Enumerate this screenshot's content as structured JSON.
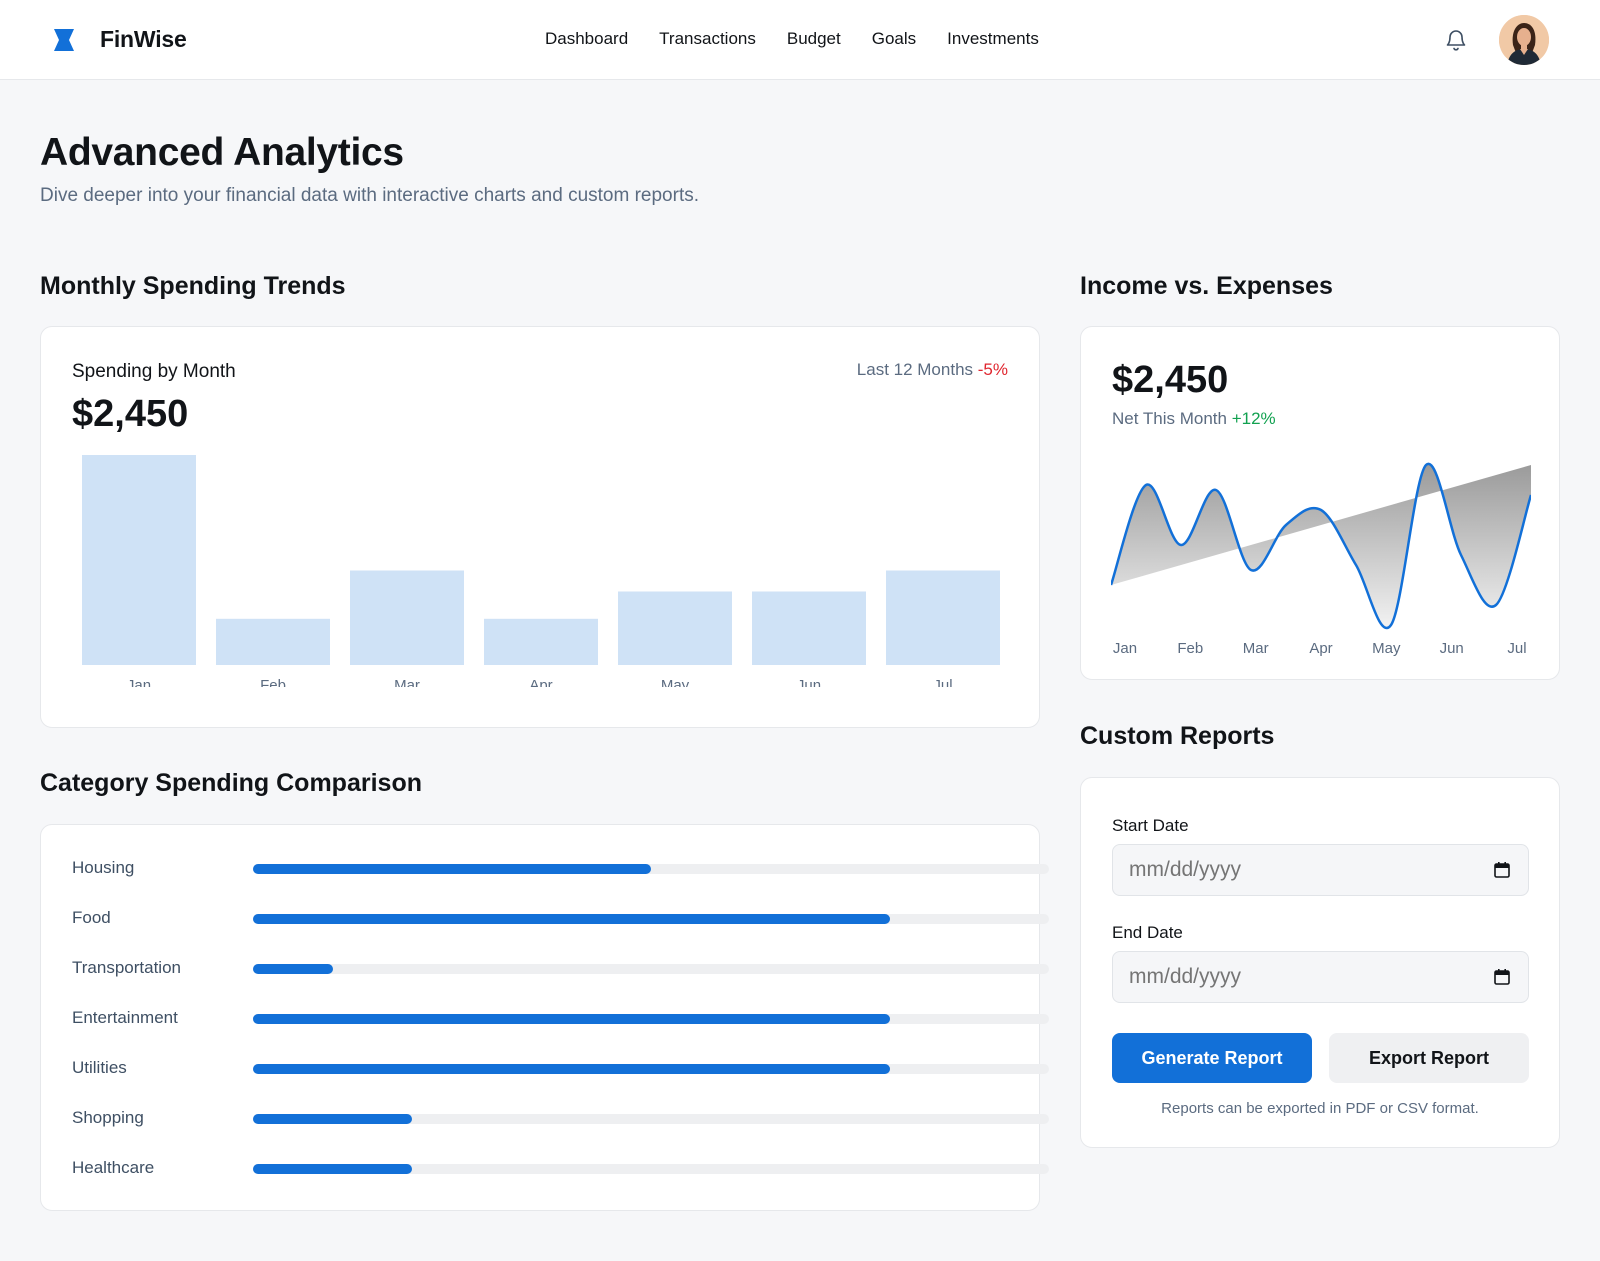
{
  "app": {
    "brand": "FinWise",
    "nav": [
      "Dashboard",
      "Transactions",
      "Budget",
      "Goals",
      "Investments"
    ],
    "accent": "#1270d8"
  },
  "page": {
    "title": "Advanced Analytics",
    "subtitle": "Dive deeper into your financial data with interactive charts and custom reports."
  },
  "spending": {
    "section_title": "Monthly Spending Trends",
    "label": "Spending by Month",
    "value": "$2,450",
    "range_label": "Last 12 Months",
    "change": "-5%"
  },
  "income": {
    "section_title": "Income vs. Expenses",
    "value": "$2,450",
    "label": "Net This Month",
    "change": "+12%"
  },
  "categories": {
    "section_title": "Category Spending Comparison",
    "items": [
      {
        "name": "Housing",
        "fraction": 0.5
      },
      {
        "name": "Food",
        "fraction": 0.8
      },
      {
        "name": "Transportation",
        "fraction": 0.1
      },
      {
        "name": "Entertainment",
        "fraction": 0.8
      },
      {
        "name": "Utilities",
        "fraction": 0.8
      },
      {
        "name": "Shopping",
        "fraction": 0.2
      },
      {
        "name": "Healthcare",
        "fraction": 0.2
      }
    ]
  },
  "reports": {
    "section_title": "Custom Reports",
    "start_label": "Start Date",
    "end_label": "End Date",
    "date_placeholder": "mm/dd/yyyy",
    "generate_label": "Generate Report",
    "export_label": "Export Report",
    "note": "Reports can be exported in PDF or CSV format."
  },
  "chart_data": [
    {
      "type": "bar",
      "categories": [
        "Jan",
        "Feb",
        "Mar",
        "Apr",
        "May",
        "Jun",
        "Jul"
      ],
      "values": [
        100,
        22,
        45,
        22,
        35,
        35,
        45
      ],
      "ylim": [
        0,
        100
      ],
      "grid": false
    },
    {
      "type": "area",
      "x": [
        "Jan",
        "Feb",
        "Mar",
        "Apr",
        "May",
        "Jun",
        "Jul"
      ],
      "series": [
        {
          "values": [
            0,
            100,
            40,
            95,
            15,
            60,
            75,
            20,
            -40,
            120,
            30,
            -20,
            90
          ]
        },
        {
          "values": [
            0,
            10,
            20,
            30,
            40,
            50,
            60,
            70,
            80,
            90,
            100,
            110,
            120
          ]
        }
      ],
      "grid": false
    }
  ]
}
